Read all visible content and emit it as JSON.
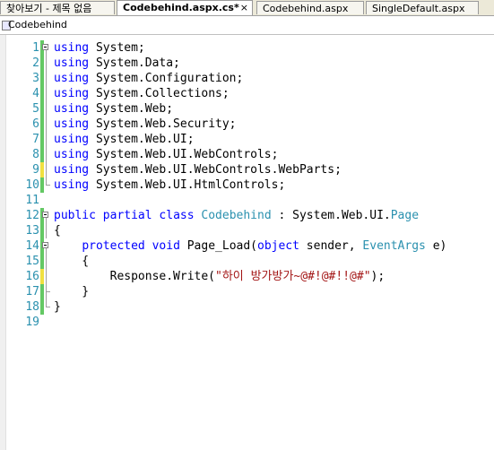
{
  "tabs": [
    {
      "label": "찾아보기 - 제목 없음",
      "active": false
    },
    {
      "label": "Codebehind.aspx.cs*",
      "active": true
    },
    {
      "label": "Codebehind.aspx",
      "active": false
    },
    {
      "label": "SingleDefault.aspx",
      "active": false
    }
  ],
  "tab_close": "×",
  "navbar": {
    "label": "Codebehind"
  },
  "colors": {
    "keyword": "#0000ff",
    "type": "#2b91af",
    "string": "#a31515",
    "line_number": "#2b91af"
  },
  "editor": {
    "lines": [
      {
        "num": "1",
        "tokens": [
          {
            "t": "using",
            "c": "kw"
          },
          {
            "t": " System;"
          }
        ]
      },
      {
        "num": "2",
        "tokens": [
          {
            "t": "using",
            "c": "kw"
          },
          {
            "t": " System.Data;"
          }
        ]
      },
      {
        "num": "3",
        "tokens": [
          {
            "t": "using",
            "c": "kw"
          },
          {
            "t": " System.Configuration;"
          }
        ]
      },
      {
        "num": "4",
        "tokens": [
          {
            "t": "using",
            "c": "kw"
          },
          {
            "t": " System.Collections;"
          }
        ]
      },
      {
        "num": "5",
        "tokens": [
          {
            "t": "using",
            "c": "kw"
          },
          {
            "t": " System.Web;"
          }
        ]
      },
      {
        "num": "6",
        "tokens": [
          {
            "t": "using",
            "c": "kw"
          },
          {
            "t": " System.Web.Security;"
          }
        ]
      },
      {
        "num": "7",
        "tokens": [
          {
            "t": "using",
            "c": "kw"
          },
          {
            "t": " System.Web.UI;"
          }
        ]
      },
      {
        "num": "8",
        "tokens": [
          {
            "t": "using",
            "c": "kw"
          },
          {
            "t": " System.Web.UI.WebControls;"
          }
        ]
      },
      {
        "num": "9",
        "tokens": [
          {
            "t": "using",
            "c": "kw"
          },
          {
            "t": " System.Web.UI.WebControls.WebParts;"
          }
        ]
      },
      {
        "num": "10",
        "tokens": [
          {
            "t": "using",
            "c": "kw"
          },
          {
            "t": " System.Web.UI.HtmlControls;"
          }
        ]
      },
      {
        "num": "11",
        "tokens": []
      },
      {
        "num": "12",
        "tokens": [
          {
            "t": "public",
            "c": "kw"
          },
          {
            "t": " "
          },
          {
            "t": "partial",
            "c": "kw"
          },
          {
            "t": " "
          },
          {
            "t": "class",
            "c": "kw"
          },
          {
            "t": " "
          },
          {
            "t": "Codebehind",
            "c": "ty"
          },
          {
            "t": " : System.Web.UI."
          },
          {
            "t": "Page",
            "c": "ty"
          }
        ]
      },
      {
        "num": "13",
        "tokens": [
          {
            "t": "{"
          }
        ]
      },
      {
        "num": "14",
        "tokens": [
          {
            "t": "    "
          },
          {
            "t": "protected",
            "c": "kw"
          },
          {
            "t": " "
          },
          {
            "t": "void",
            "c": "kw"
          },
          {
            "t": " Page_Load("
          },
          {
            "t": "object",
            "c": "kw"
          },
          {
            "t": " sender, "
          },
          {
            "t": "EventArgs",
            "c": "ty"
          },
          {
            "t": " e)"
          }
        ]
      },
      {
        "num": "15",
        "tokens": [
          {
            "t": "    {"
          }
        ]
      },
      {
        "num": "16",
        "tokens": [
          {
            "t": "        Response.Write("
          },
          {
            "t": "\"하이 방가방가~@#!@#!!@#\"",
            "c": "str"
          },
          {
            "t": ");"
          }
        ]
      },
      {
        "num": "17",
        "tokens": [
          {
            "t": "    }"
          }
        ]
      },
      {
        "num": "18",
        "tokens": [
          {
            "t": "}"
          }
        ]
      },
      {
        "num": "19",
        "tokens": []
      }
    ]
  }
}
